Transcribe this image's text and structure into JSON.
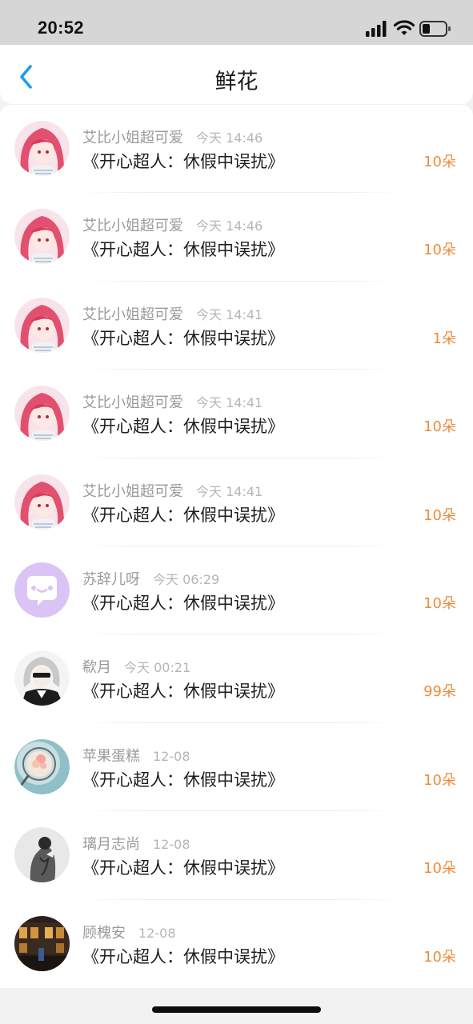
{
  "status": {
    "time": "20:52"
  },
  "header": {
    "title": "鲜花",
    "back_icon": "chevron-left-icon"
  },
  "colors": {
    "accent": "#1e9bf0",
    "count": "#ee8c3c",
    "status_bg": "#d6d6d6",
    "page_bg": "#f2f2f2"
  },
  "items": [
    {
      "user": "艾比小姐超可爱",
      "time": "今天 14:46",
      "work": "《开心超人：休假中误扰》",
      "count": "10朵"
    },
    {
      "user": "艾比小姐超可爱",
      "time": "今天 14:46",
      "work": "《开心超人：休假中误扰》",
      "count": "10朵"
    },
    {
      "user": "艾比小姐超可爱",
      "time": "今天 14:41",
      "work": "《开心超人：休假中误扰》",
      "count": "1朵"
    },
    {
      "user": "艾比小姐超可爱",
      "time": "今天 14:41",
      "work": "《开心超人：休假中误扰》",
      "count": "10朵"
    },
    {
      "user": "艾比小姐超可爱",
      "time": "今天 14:41",
      "work": "《开心超人：休假中误扰》",
      "count": "10朵"
    },
    {
      "user": "苏辞儿呀",
      "time": "今天 06:29",
      "work": "《开心超人：休假中误扰》",
      "count": "10朵"
    },
    {
      "user": "欷月",
      "time": "今天 00:21",
      "work": "《开心超人：休假中误扰》",
      "count": "99朵"
    },
    {
      "user": "苹果蛋糕",
      "time": "12-08",
      "work": "《开心超人：休假中误扰》",
      "count": "10朵"
    },
    {
      "user": "璃月志尚",
      "time": "12-08",
      "work": "《开心超人：休假中误扰》",
      "count": "10朵"
    },
    {
      "user": "顾槐安",
      "time": "12-08",
      "work": "《开心超人：休假中误扰》",
      "count": "10朵"
    }
  ]
}
